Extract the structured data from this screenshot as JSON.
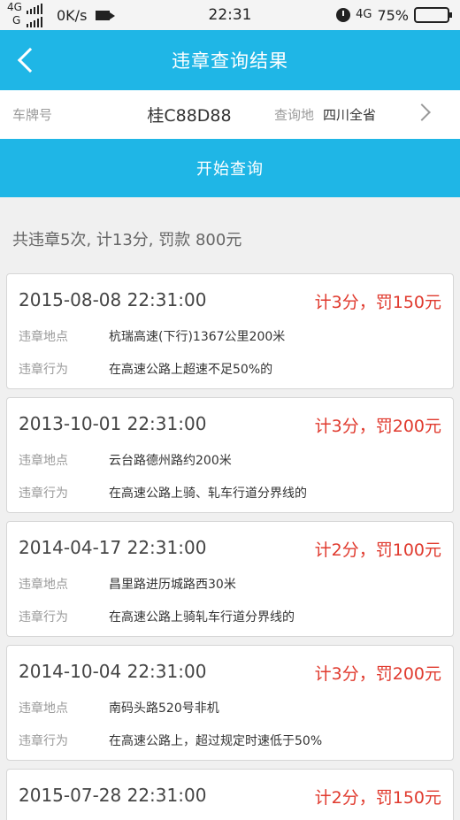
{
  "status_bar": {
    "net_top": "4G",
    "net_bottom": "G",
    "speed": "0K/s",
    "time": "22:31",
    "net_type": "4G",
    "battery": "75%",
    "battery_level": 0.75
  },
  "header": {
    "title": "违章查询结果"
  },
  "query": {
    "plate_label": "车牌号",
    "plate_value": "桂C88D88",
    "region_label": "查询地",
    "region_value": "四川全省"
  },
  "button": {
    "start_query": "开始查询"
  },
  "summary": "共违章5次, 计13分, 罚款 800元",
  "records": [
    {
      "datetime": "2015-08-08 22:31:00",
      "penalty": "计3分，罚150元",
      "location_label": "违章地点",
      "location": "杭瑞高速(下行)1367公里200米",
      "behavior_label": "违章行为",
      "behavior": "在高速公路上超速不足50%的"
    },
    {
      "datetime": "2013-10-01 22:31:00",
      "penalty": "计3分，罚200元",
      "location_label": "违章地点",
      "location": "云台路德州路约200米",
      "behavior_label": "违章行为",
      "behavior": "在高速公路上骑、轧车行道分界线的"
    },
    {
      "datetime": "2014-04-17 22:31:00",
      "penalty": "计2分，罚100元",
      "location_label": "违章地点",
      "location": "昌里路进历城路西30米",
      "behavior_label": "违章行为",
      "behavior": "在高速公路上骑轧车行道分界线的"
    },
    {
      "datetime": "2014-10-04 22:31:00",
      "penalty": "计3分，罚200元",
      "location_label": "违章地点",
      "location": "南码头路520号非机",
      "behavior_label": "违章行为",
      "behavior": "在高速公路上，超过规定时速低于50%"
    },
    {
      "datetime": "2015-07-28 22:31:00",
      "penalty": "计2分，罚150元"
    }
  ],
  "colors": {
    "primary": "#1fb6e6",
    "penalty": "#e03a2e"
  }
}
